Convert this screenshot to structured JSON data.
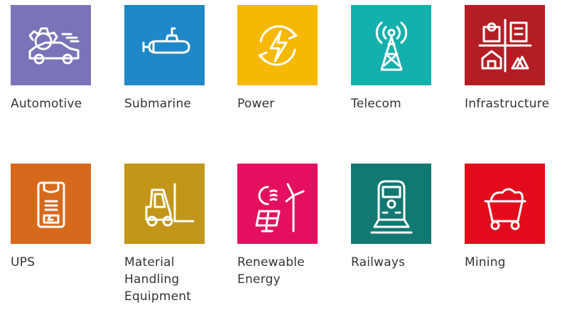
{
  "industries": [
    {
      "label": "Automotive",
      "color": "#7a73b8",
      "icon": "gear-car-icon"
    },
    {
      "label": "Submarine",
      "color": "#1e88c9",
      "icon": "submarine-icon"
    },
    {
      "label": "Power",
      "color": "#f6b800",
      "icon": "power-cycle-icon"
    },
    {
      "label": "Telecom",
      "color": "#14b0ab",
      "icon": "telecom-tower-icon"
    },
    {
      "label": "Infrastructure",
      "color": "#b41d24",
      "icon": "buildings-icon"
    },
    {
      "label": "UPS",
      "color": "#d7691d",
      "icon": "ups-battery-icon"
    },
    {
      "label": "Material\nHandling\nEquipment",
      "color": "#c29618",
      "icon": "forklift-icon"
    },
    {
      "label": "Renewable\nEnergy",
      "color": "#e4105f",
      "icon": "solar-wind-icon"
    },
    {
      "label": "Railways",
      "color": "#117872",
      "icon": "train-icon"
    },
    {
      "label": "Mining",
      "color": "#e30b1b",
      "icon": "mining-cart-icon"
    }
  ]
}
